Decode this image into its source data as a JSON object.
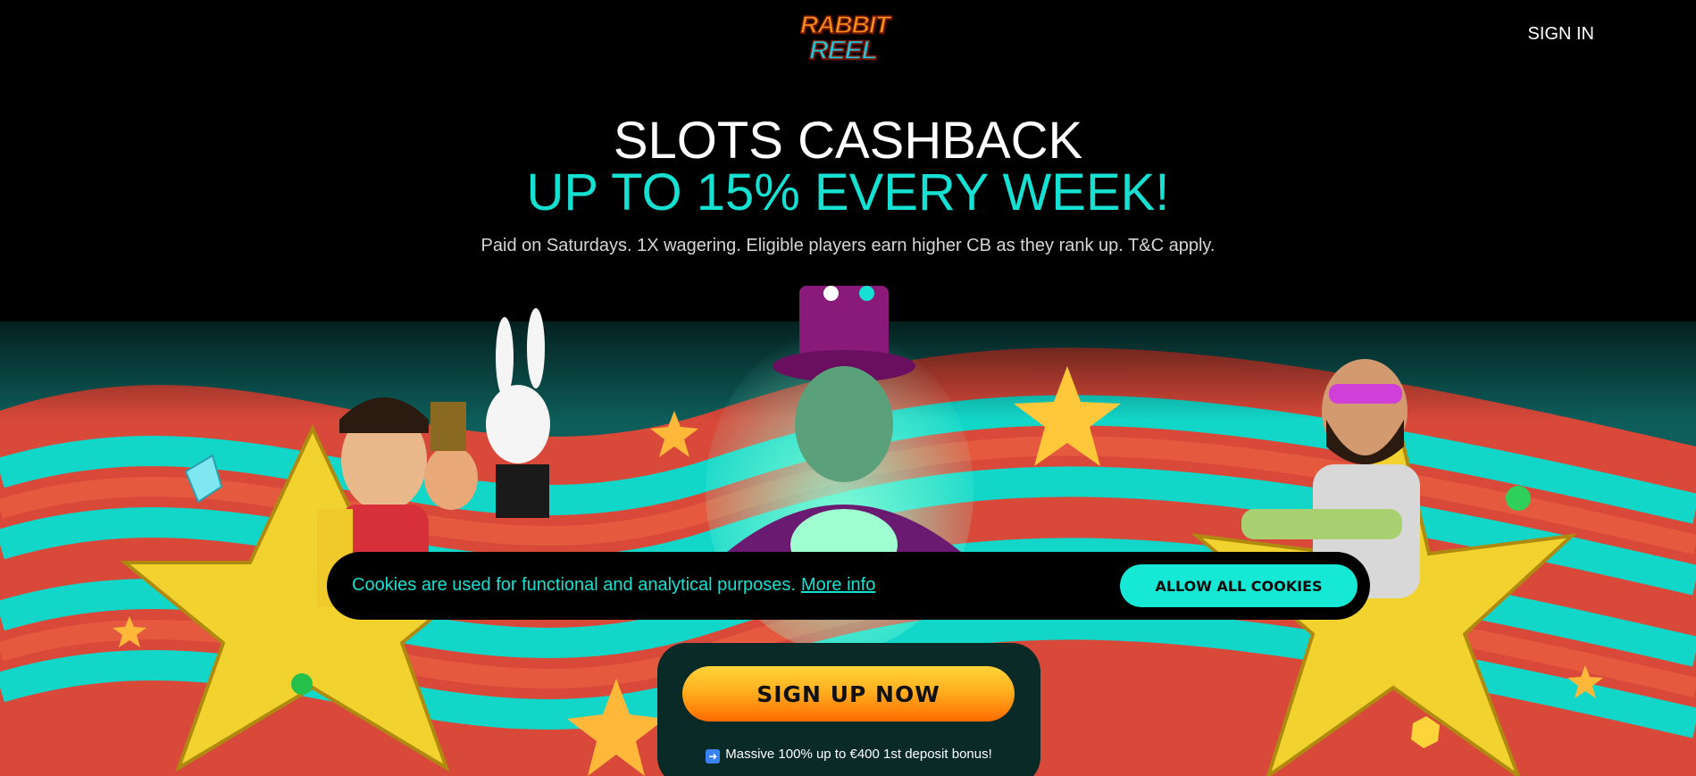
{
  "header": {
    "logo_line1": "RABBIT",
    "logo_line2": "REEL",
    "sign_in_label": "SIGN IN"
  },
  "hero": {
    "title": "SLOTS CASHBACK",
    "subtitle": "UP TO 15% EVERY WEEK!",
    "description": "Paid on Saturdays. 1X wagering. Eligible players earn higher CB as they rank up. T&C apply."
  },
  "carousel": {
    "slides": 2,
    "active_slide": 2
  },
  "cookie_banner": {
    "text": "Cookies are used for functional and analytical purposes.",
    "link_label": "More info",
    "button_label": "ALLOW ALL COOKIES"
  },
  "signup": {
    "button_label": "SIGN UP NOW",
    "bonus_icon": "➡️",
    "bonus_text": "Massive 100% up to €400 1st deposit bonus!"
  },
  "colors": {
    "accent": "#16e0d2",
    "signup_gradient_top": "#ffd33a",
    "signup_gradient_bottom": "#ff6a00",
    "background": "#000000"
  }
}
